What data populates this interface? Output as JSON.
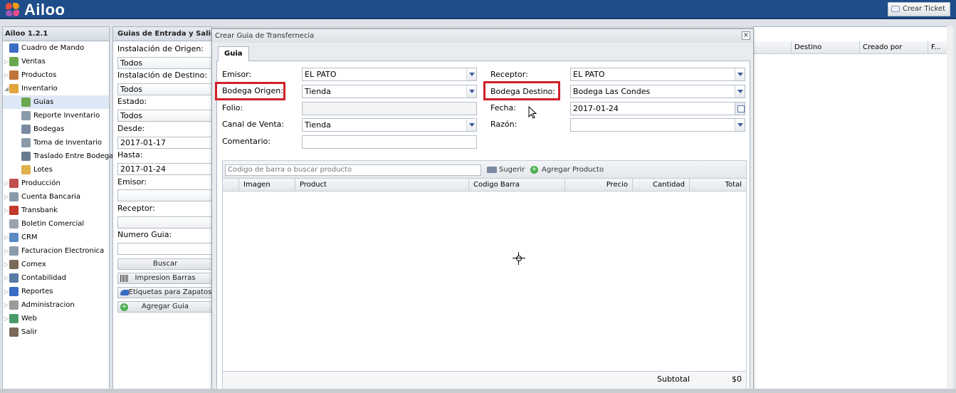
{
  "app": {
    "logo_text": "Ailoo",
    "ticket_label": "Crear Ticket",
    "version": "Ailoo 1.2.1"
  },
  "colors": {
    "topbar": "#1f4d8a",
    "highlight_box": "#d0202a",
    "selection": "#dfe8f6"
  },
  "sidebar": {
    "items": [
      {
        "label": "Cuadro de Mando",
        "icon": "chart-icon",
        "level": 0,
        "expandable": false
      },
      {
        "label": "Ventas",
        "icon": "sales-icon",
        "level": 0,
        "expandable": true
      },
      {
        "label": "Productos",
        "icon": "products-icon",
        "level": 0,
        "expandable": true
      },
      {
        "label": "Inventario",
        "icon": "inventory-icon",
        "level": 0,
        "expandable": true,
        "expanded": true
      },
      {
        "label": "Guias",
        "icon": "guide-icon",
        "level": 1,
        "selected": true
      },
      {
        "label": "Reporte Inventario",
        "icon": "report-icon",
        "level": 1
      },
      {
        "label": "Bodegas",
        "icon": "warehouse-icon",
        "level": 1
      },
      {
        "label": "Toma de Inventario",
        "icon": "count-icon",
        "level": 1
      },
      {
        "label": "Traslado Entre Bodegas",
        "icon": "truck-icon",
        "level": 1
      },
      {
        "label": "Lotes",
        "icon": "box-icon",
        "level": 1
      },
      {
        "label": "Producción",
        "icon": "factory-icon",
        "level": 0,
        "expandable": true
      },
      {
        "label": "Cuenta Bancaria",
        "icon": "bank-icon",
        "level": 0,
        "expandable": true
      },
      {
        "label": "Transbank",
        "icon": "transbank-icon",
        "level": 0,
        "expandable": true
      },
      {
        "label": "Boletin Comercial",
        "icon": "tag-icon",
        "level": 0,
        "expandable": false
      },
      {
        "label": "CRM",
        "icon": "crm-icon",
        "level": 0,
        "expandable": true
      },
      {
        "label": "Facturacion Electronica",
        "icon": "invoice-icon",
        "level": 0,
        "expandable": true
      },
      {
        "label": "Comex",
        "icon": "comex-icon",
        "level": 0,
        "expandable": true
      },
      {
        "label": "Contabilidad",
        "icon": "accounting-icon",
        "level": 0,
        "expandable": true
      },
      {
        "label": "Reportes",
        "icon": "reports-icon",
        "level": 0,
        "expandable": true
      },
      {
        "label": "Administracion",
        "icon": "admin-icon",
        "level": 0,
        "expandable": true
      },
      {
        "label": "Web",
        "icon": "globe-icon",
        "level": 0,
        "expandable": true
      },
      {
        "label": "Salir",
        "icon": "exit-icon",
        "level": 0,
        "expandable": false
      }
    ]
  },
  "filters": {
    "title": "Guias de Entrada y Salida",
    "origen_label": "Instalación de Origen:",
    "origen_value": "Todos",
    "destino_label": "Instalación de Destino:",
    "destino_value": "Todos",
    "estado_label": "Estado:",
    "estado_value": "Todos",
    "desde_label": "Desde:",
    "desde_value": "2017-01-17",
    "hasta_label": "Hasta:",
    "hasta_value": "2017-01-24",
    "emisor_label": "Emisor:",
    "emisor_value": "",
    "receptor_label": "Receptor:",
    "receptor_value": "",
    "numero_label": "Numero Guia:",
    "numero_value": "",
    "buscar": "Buscar",
    "impresion": "Impresion Barras",
    "etiquetas": "Etiquetas para Zapatos",
    "agregar": "Agregar Guia"
  },
  "grid": {
    "columns": [
      "Destino",
      "Creado por",
      "F..."
    ]
  },
  "dialog": {
    "title": "Crear Guia de Transfernecia",
    "tab": "Guia",
    "emisor_label": "Emisor:",
    "emisor_value": "EL PATO",
    "bodega_origen_label": "Bodega Origen:",
    "bodega_origen_value": "Tienda",
    "folio_label": "Folio:",
    "folio_value": "",
    "canal_label": "Canal de Venta:",
    "canal_value": "Tienda",
    "comentario_label": "Comentario:",
    "comentario_value": "",
    "receptor_label": "Receptor:",
    "receptor_value": "EL PATO",
    "bodega_destino_label": "Bodega Destino:",
    "bodega_destino_value": "Bodega Las Condes",
    "fecha_label": "Fecha:",
    "fecha_value": "2017-01-24",
    "razon_label": "Razón:",
    "razon_value": "",
    "search_placeholder": "Codigo de barra o buscar producto",
    "sugerir": "Sugerir",
    "agregar_producto": "Agregar Producto",
    "columns": [
      "Imagen",
      "Product",
      "Codigo Barra",
      "Precio",
      "Cantidad",
      "Total"
    ],
    "subtotal_label": "Subtotal",
    "subtotal_value": "$0"
  }
}
